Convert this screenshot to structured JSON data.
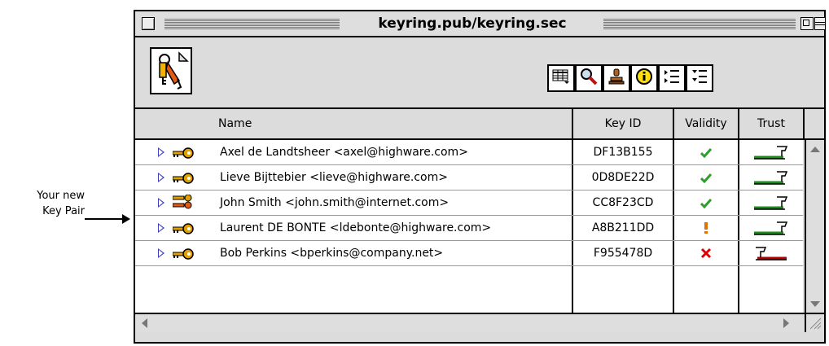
{
  "annotation": {
    "line1": "Your new",
    "line2": "Key Pair"
  },
  "window": {
    "title": "keyring.pub/keyring.sec"
  },
  "toolbar": {
    "buttons": [
      "column-view-icon",
      "search-icon",
      "sign-stamp-icon",
      "info-icon",
      "collapse-list-icon",
      "expand-list-icon"
    ]
  },
  "table": {
    "headers": {
      "name": "Name",
      "key_id": "Key ID",
      "validity": "Validity",
      "trust": "Trust"
    },
    "rows": [
      {
        "name": "Axel de Landtsheer <axel@highware.com>",
        "key_id": "DF13B155",
        "validity": "valid",
        "trust": "full",
        "key_type": "single-key"
      },
      {
        "name": "Lieve Bijttebier <lieve@highware.com>",
        "key_id": "0D8DE22D",
        "validity": "valid",
        "trust": "full",
        "key_type": "single-key"
      },
      {
        "name": "John Smith <john.smith@internet.com>",
        "key_id": "CC8F23CD",
        "validity": "valid",
        "trust": "full",
        "key_type": "key-pair"
      },
      {
        "name": "Laurent DE BONTE <ldebonte@highware.com>",
        "key_id": "A8B211DD",
        "validity": "marginal",
        "trust": "full",
        "key_type": "single-key"
      },
      {
        "name": "Bob Perkins <bperkins@company.net>",
        "key_id": "F955478D",
        "validity": "invalid",
        "trust": "none",
        "key_type": "single-key"
      }
    ]
  },
  "colors": {
    "valid": "#2e9e2e",
    "marginal": "#e07000",
    "invalid": "#e00000",
    "trust_full": "#1a8a1a",
    "trust_none": "#b00000",
    "expand_triangle": "#4040c0",
    "key": "#e0a000"
  }
}
